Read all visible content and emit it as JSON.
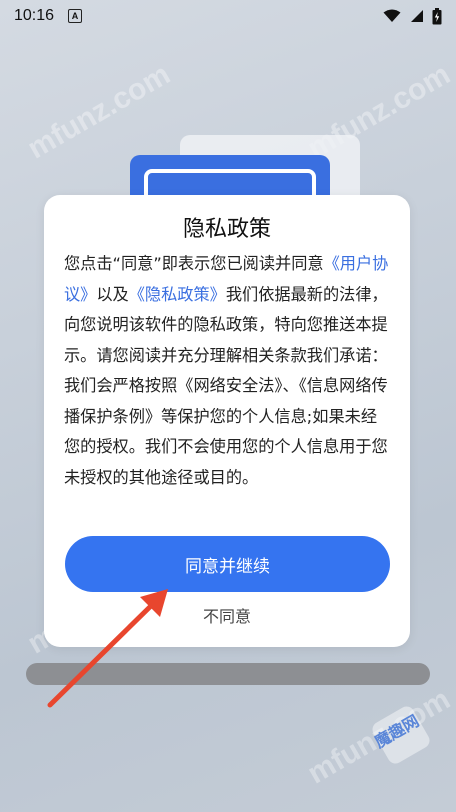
{
  "status_bar": {
    "time": "10:16",
    "notification_icon": "A"
  },
  "dialog": {
    "title": "隐私政策",
    "body_part1": "您点击“同意”即表示您已阅读并同意",
    "link_user_agreement": "《用户协议》",
    "body_part2": "以及",
    "link_privacy_policy": "《隐私政策》",
    "body_part3": "我们依据最新的法律，向您说明该软件的隐私政策，特向您推送本提示。请您阅读并充分理解相关条款我们承诺：",
    "body_part4": "我们会严格按照《网络安全法》、《信息网络传播保护条例》等保护您的个人信息;如果未经您的授权。我们不会使用您的个人信息用于您未授权的其他途径或目的。",
    "agree_label": "同意并继续",
    "disagree_label": "不同意"
  },
  "watermark_text": "mfunz.com",
  "watermark_logo_text": "魔趣网",
  "colors": {
    "primary": "#3574f0",
    "link": "#3a6fe0",
    "arrow": "#e8462e"
  }
}
